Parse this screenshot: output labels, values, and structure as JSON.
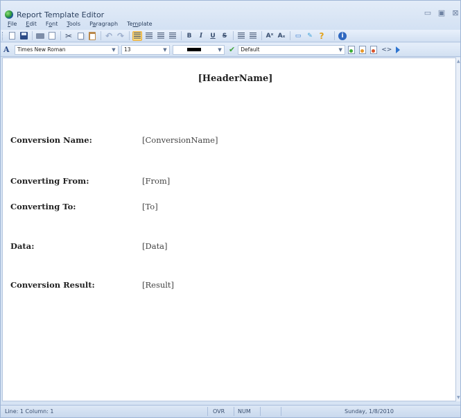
{
  "window": {
    "title": "Report Template Editor",
    "controls": {
      "minimize": "▭",
      "maximize": "▣",
      "close": "⊠"
    }
  },
  "menu": [
    {
      "accel": "F",
      "rest": "ile"
    },
    {
      "accel": "E",
      "rest": "dit"
    },
    {
      "pre": "F",
      "accel": "o",
      "rest": "nt"
    },
    {
      "accel": "T",
      "rest": "ools"
    },
    {
      "pre": "P",
      "accel": "a",
      "rest": "ragraph"
    },
    {
      "pre": "Te",
      "accel": "m",
      "rest": "plate"
    }
  ],
  "toolbar": {
    "font_name": "Times New Roman",
    "font_size": "13",
    "text_color": "#000000",
    "style_name": "Default",
    "bold": "B",
    "italic": "I",
    "underline": "U",
    "strike": "S",
    "superscript": "Aˣ",
    "subscript": "Aₓ"
  },
  "document": {
    "header": "[HeaderName]",
    "fields": [
      {
        "label": "Conversion Name:",
        "value": "[ConversionName]"
      },
      {
        "label": "Converting From:",
        "value": "[From]"
      },
      {
        "label": "Converting To:",
        "value": "[To]"
      },
      {
        "label": "Data:",
        "value": "[Data]"
      },
      {
        "label": "Conversion Result:",
        "value": "[Result]"
      }
    ]
  },
  "status": {
    "position": "Line: 1  Column: 1",
    "ovr": "OVR",
    "num": "NUM",
    "date": "Sunday, 1/8/2010"
  },
  "colors": {
    "accent_active": "#fbd879",
    "chrome": "#d6e3f3"
  }
}
